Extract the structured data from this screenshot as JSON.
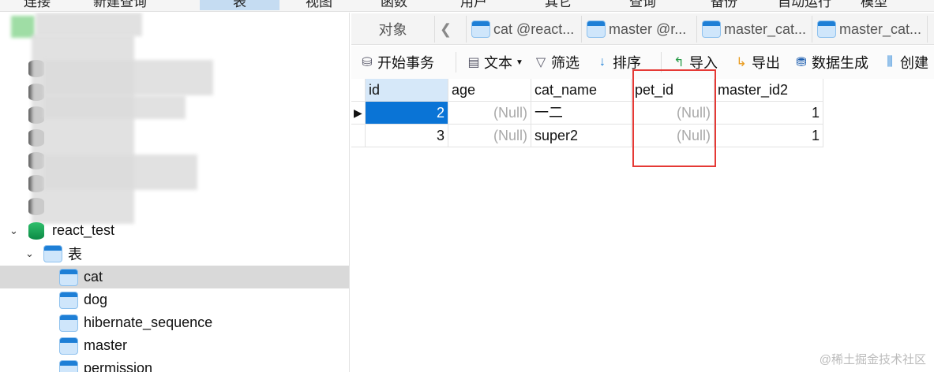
{
  "menubar": {
    "items": [
      "连接",
      "新建查询",
      "表",
      "视图",
      "函数",
      "用户",
      "其它",
      "查询",
      "备份",
      "自动运行",
      "模型"
    ],
    "active": "表"
  },
  "tree": {
    "database": "react_test",
    "group": "表",
    "tables": [
      "cat",
      "dog",
      "hibernate_sequence",
      "master",
      "permission"
    ],
    "selected": "cat"
  },
  "tabs": {
    "objects": "对象",
    "scroll_left": "❮",
    "items": [
      "cat @react...",
      "master @r...",
      "master_cat...",
      "master_cat..."
    ]
  },
  "toolbar": {
    "begin_tx": "开始事务",
    "text": "文本",
    "filter": "筛选",
    "sort": "排序",
    "import": "导入",
    "export": "导出",
    "datagen": "数据生成",
    "create": "创建"
  },
  "grid": {
    "columns": [
      "id",
      "age",
      "cat_name",
      "pet_id",
      "master_id2"
    ],
    "rows": [
      [
        "2",
        "(Null)",
        "一二",
        "(Null)",
        "1"
      ],
      [
        "3",
        "(Null)",
        "super2",
        "(Null)",
        "1"
      ]
    ]
  },
  "watermark": "@稀土掘金技术社区",
  "colors": {
    "accent": "#0a74d6",
    "highlight": "#e53935"
  }
}
